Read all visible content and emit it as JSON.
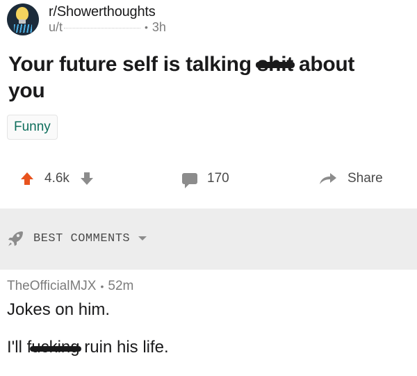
{
  "post": {
    "subreddit": "r/Showerthoughts",
    "user_prefix": "u/t",
    "age": "3h",
    "title_before": "Your future self is talking ",
    "title_censored": "shit",
    "title_after": " about you",
    "flair": "Funny"
  },
  "actions": {
    "upvotes": "4.6k",
    "comments": "170",
    "share": "Share"
  },
  "sort": {
    "label": "BEST COMMENTS"
  },
  "comment": {
    "author": "TheOfficialMJX",
    "age": "52m",
    "line1": "Jokes on him.",
    "line2_before": "I'll f",
    "line2_censored": "ucking",
    "line2_after": " ruin his life."
  },
  "colors": {
    "upvote": "#e8531e",
    "flair_text": "#0e6e5c",
    "sort_bar_bg": "#ededed"
  }
}
